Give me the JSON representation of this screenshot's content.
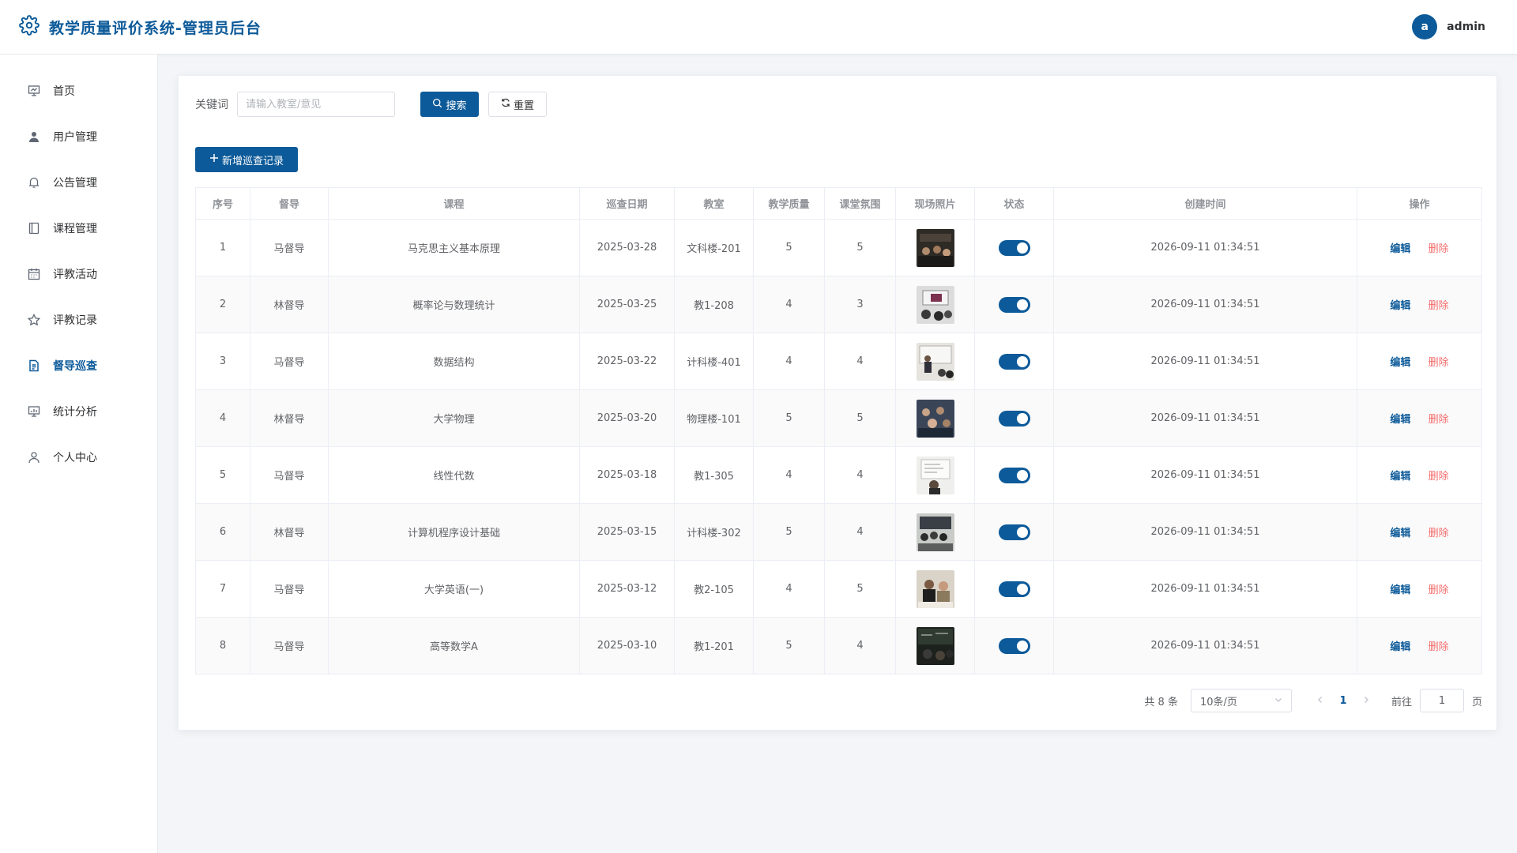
{
  "app": {
    "title": "教学质量评价系统-管理员后台"
  },
  "user": {
    "avatar_letter": "a",
    "name": "admin"
  },
  "sidebar": {
    "items": [
      {
        "label": "首页",
        "icon": "presentation-board-icon"
      },
      {
        "label": "用户管理",
        "icon": "user-icon"
      },
      {
        "label": "公告管理",
        "icon": "bell-icon"
      },
      {
        "label": "课程管理",
        "icon": "book-icon"
      },
      {
        "label": "评教活动",
        "icon": "calendar-icon"
      },
      {
        "label": "评教记录",
        "icon": "star-icon"
      },
      {
        "label": "督导巡查",
        "icon": "document-icon",
        "active": true
      },
      {
        "label": "统计分析",
        "icon": "chart-board-icon"
      },
      {
        "label": "个人中心",
        "icon": "user-outline-icon"
      }
    ]
  },
  "search": {
    "label": "关键词",
    "placeholder": "请输入教室/意见",
    "value": "",
    "search_label": "搜索",
    "reset_label": "重置"
  },
  "toolbar": {
    "add_label": "新增巡查记录"
  },
  "table": {
    "columns": [
      "序号",
      "督导",
      "课程",
      "巡查日期",
      "教室",
      "教学质量",
      "课堂氛围",
      "现场照片",
      "状态",
      "创建时间",
      "操作"
    ],
    "edit_label": "编辑",
    "delete_label": "删除",
    "rows": [
      {
        "no": "1",
        "supervisor": "马督导",
        "course": "马克思主义基本原理",
        "date": "2025-03-28",
        "room": "文科楼-201",
        "quality": "5",
        "atmosphere": "5",
        "status": true,
        "created": "2026-09-11 01:34:51"
      },
      {
        "no": "2",
        "supervisor": "林督导",
        "course": "概率论与数理统计",
        "date": "2025-03-25",
        "room": "教1-208",
        "quality": "4",
        "atmosphere": "3",
        "status": true,
        "created": "2026-09-11 01:34:51"
      },
      {
        "no": "3",
        "supervisor": "马督导",
        "course": "数据结构",
        "date": "2025-03-22",
        "room": "计科楼-401",
        "quality": "4",
        "atmosphere": "4",
        "status": true,
        "created": "2026-09-11 01:34:51"
      },
      {
        "no": "4",
        "supervisor": "林督导",
        "course": "大学物理",
        "date": "2025-03-20",
        "room": "物理楼-101",
        "quality": "5",
        "atmosphere": "5",
        "status": true,
        "created": "2026-09-11 01:34:51"
      },
      {
        "no": "5",
        "supervisor": "马督导",
        "course": "线性代数",
        "date": "2025-03-18",
        "room": "教1-305",
        "quality": "4",
        "atmosphere": "4",
        "status": true,
        "created": "2026-09-11 01:34:51"
      },
      {
        "no": "6",
        "supervisor": "林督导",
        "course": "计算机程序设计基础",
        "date": "2025-03-15",
        "room": "计科楼-302",
        "quality": "5",
        "atmosphere": "4",
        "status": true,
        "created": "2026-09-11 01:34:51"
      },
      {
        "no": "7",
        "supervisor": "马督导",
        "course": "大学英语(一)",
        "date": "2025-03-12",
        "room": "教2-105",
        "quality": "4",
        "atmosphere": "5",
        "status": true,
        "created": "2026-09-11 01:34:51"
      },
      {
        "no": "8",
        "supervisor": "马督导",
        "course": "高等数学A",
        "date": "2025-03-10",
        "room": "教1-201",
        "quality": "5",
        "atmosphere": "4",
        "status": true,
        "created": "2026-09-11 01:34:51"
      }
    ]
  },
  "pagination": {
    "total_text": "共 8 条",
    "page_size": "10条/页",
    "current_page": "1",
    "goto_label": "前往",
    "goto_value": "1",
    "page_unit": "页"
  },
  "colors": {
    "primary": "#0c5a99",
    "danger": "#f56c6c",
    "background": "#f3f5f8"
  }
}
